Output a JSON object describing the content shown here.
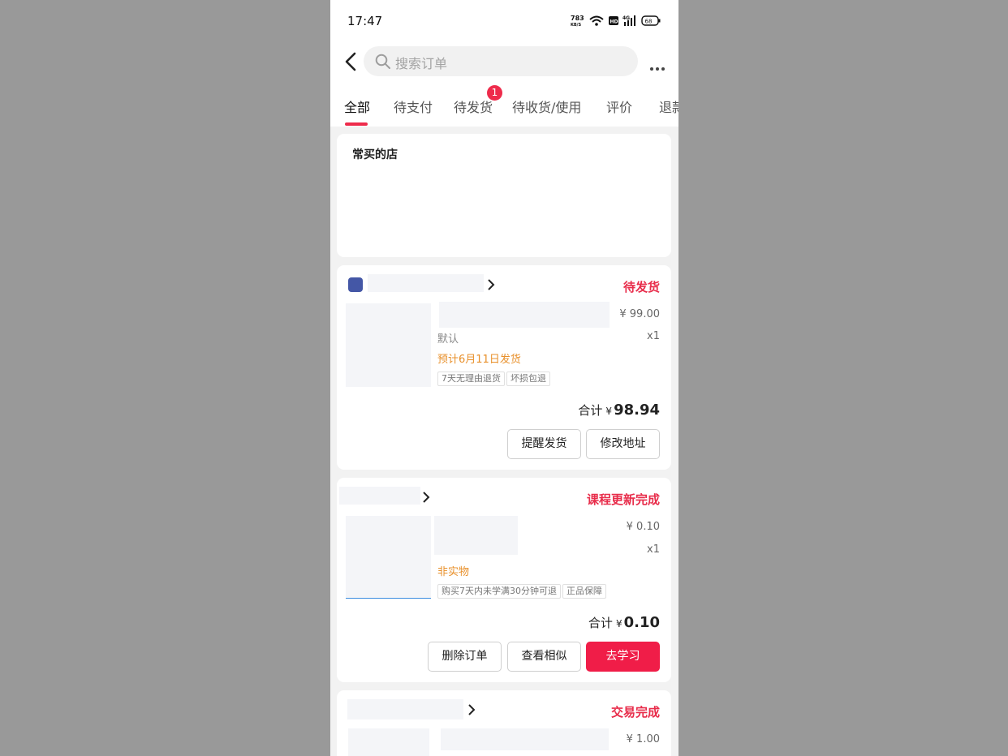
{
  "status_bar": {
    "time": "17:47",
    "net_speed_top": "783",
    "net_speed_bottom": "KB/S",
    "hd": "HD",
    "signal_label": "4G",
    "battery": "68"
  },
  "search": {
    "placeholder": "搜索订单"
  },
  "tabs": [
    {
      "label": "全部",
      "active": true
    },
    {
      "label": "待支付"
    },
    {
      "label": "待发货",
      "badge": "1"
    },
    {
      "label": "待收货/使用"
    },
    {
      "label": "评价"
    },
    {
      "label": "退款"
    }
  ],
  "frequent_shops": {
    "title": "常买的店"
  },
  "orders": [
    {
      "status": "待发货",
      "price": "¥ 99.00",
      "qty": "x1",
      "spec": "默认",
      "note": "预计6月11日发货",
      "tags": [
        "7天无理由退货",
        "坏损包退"
      ],
      "total_label": "合计",
      "currency": "¥",
      "total": "98.94",
      "buttons": [
        "提醒发货",
        "修改地址"
      ]
    },
    {
      "status": "课程更新完成",
      "price": "¥ 0.10",
      "qty": "x1",
      "note": "非实物",
      "tags": [
        "购买7天内未学满30分钟可退",
        "正品保障"
      ],
      "total_label": "合计",
      "currency": "¥",
      "total": "0.10",
      "buttons": [
        "删除订单",
        "查看相似",
        "去学习"
      ]
    },
    {
      "status": "交易完成",
      "price": "¥ 1.00"
    }
  ],
  "colors": {
    "accent": "#ee2b4b",
    "orange_note": "#e8902b",
    "page_bg": "#f2f2f2",
    "overlay": "#999999"
  }
}
